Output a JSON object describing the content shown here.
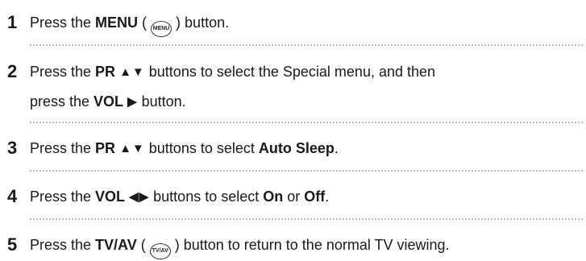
{
  "steps": [
    {
      "number": "1",
      "t1": "Press the ",
      "b1": "MENU",
      "t2": " ( ",
      "icon": "MENU",
      "t3": " ) button."
    },
    {
      "number": "2",
      "t1": "Press the ",
      "b1": "PR",
      "arrows": "▲▼",
      "t2": " buttons to select the Special menu, and then",
      "t3": "press the ",
      "b2": "VOL",
      "arrow2": "▶",
      "t4": " button."
    },
    {
      "number": "3",
      "t1": "Press the ",
      "b1": "PR",
      "arrows": "▲▼",
      "t2": " buttons to select ",
      "b2": "Auto Sleep",
      "t3": "."
    },
    {
      "number": "4",
      "t1": "Press the ",
      "b1": "VOL",
      "arrows": "◀▶",
      "t2": " buttons to select ",
      "b2": "On",
      "t3": " or ",
      "b3": "Off",
      "t4": "."
    },
    {
      "number": "5",
      "t1": "Press the ",
      "b1": "TV/AV",
      "t2": " ( ",
      "icon": "TV/AV",
      "t3": " ) button to return to the normal TV viewing."
    }
  ],
  "colors": {
    "text": "#1a1a1a",
    "divider": "#b8b8b8"
  },
  "icons": {
    "menu_button": "menu-button-icon",
    "tvav_button": "tvav-button-icon"
  }
}
